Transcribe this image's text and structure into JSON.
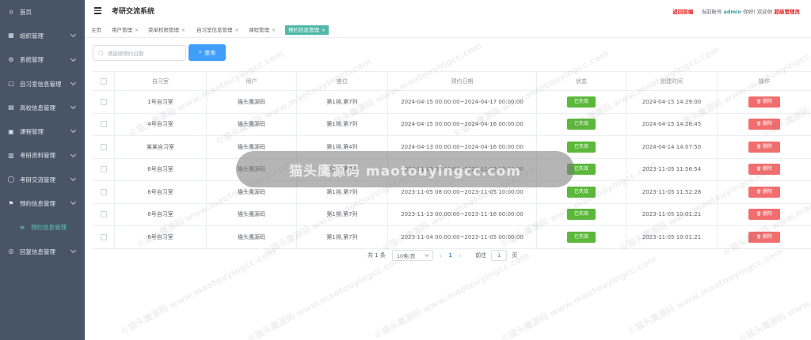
{
  "sidebar": {
    "items": [
      {
        "label": "首页",
        "icon": "home-icon",
        "glyph": "⌂"
      },
      {
        "label": "组织管理",
        "icon": "grid-icon",
        "glyph": "▦"
      },
      {
        "label": "系统管理",
        "icon": "gear-icon",
        "glyph": "⚙"
      },
      {
        "label": "自习室信息管理",
        "icon": "book-icon",
        "glyph": "▢"
      },
      {
        "label": "高校信息管理",
        "icon": "building-icon",
        "glyph": "▤"
      },
      {
        "label": "课程管理",
        "icon": "image-icon",
        "glyph": "▣"
      },
      {
        "label": "考研资料管理",
        "icon": "document-icon",
        "glyph": "▥"
      },
      {
        "label": "考研交流管理",
        "icon": "chat-icon",
        "glyph": "◯"
      },
      {
        "label": "预约信息管理",
        "icon": "flag-icon",
        "glyph": "⚑"
      },
      {
        "label": "预约信息管理",
        "icon": "list-icon",
        "glyph": "≡"
      },
      {
        "label": "回复信息管理",
        "icon": "reply-icon",
        "glyph": "◎"
      }
    ]
  },
  "header": {
    "title": "考研交流系统",
    "back_label": "返回前端",
    "account_prefix": "当前账号",
    "username": "admin",
    "greeting": "你好! 欢迎你",
    "role": "超级管理员"
  },
  "tags": [
    {
      "label": "主页",
      "closable": false,
      "active": false
    },
    {
      "label": "用户管理",
      "closable": true,
      "active": false
    },
    {
      "label": "菜单权限管理",
      "closable": true,
      "active": false
    },
    {
      "label": "自习室信息管理",
      "closable": true,
      "active": false
    },
    {
      "label": "课程管理",
      "closable": true,
      "active": false
    },
    {
      "label": "预约信息管理",
      "closable": true,
      "active": true
    }
  ],
  "search": {
    "placeholder": "请选择预约日期",
    "button_label": "查询"
  },
  "table": {
    "headers": [
      "自习室",
      "用户",
      "座位",
      "预约日期",
      "状态",
      "创建时间",
      "操作"
    ],
    "rows": [
      {
        "room": "1号自习室",
        "user": "猫头鹰源码",
        "seat": "第1排,第7列",
        "date": "2024-04-15 00:00:00~2024-04-17 00:00:00",
        "status": "已失效",
        "created": "2024-04-15 14:29:00",
        "action": "删除"
      },
      {
        "room": "4号自习室",
        "user": "猫头鹰源码",
        "seat": "第1排,第7列",
        "date": "2024-04-15 00:00:00~2024-04-16 00:00:00",
        "status": "已失效",
        "created": "2024-04-15 14:28:45",
        "action": "删除"
      },
      {
        "room": "某某自习室",
        "user": "猫头鹰源码",
        "seat": "第1排,第4列",
        "date": "2024-04-13 00:00:00~2024-04-16 00:00:00",
        "status": "已失效",
        "created": "2024-04-14 14:07:50",
        "action": "删除"
      },
      {
        "room": "6号自习室",
        "user": "猫头鹰源码",
        "seat": "第1排,第8列",
        "date": "2023-11-05 00:00:00~2023-11-06 00:00:00",
        "status": "已失效",
        "created": "2023-11-05 11:56:54",
        "action": "删除"
      },
      {
        "room": "6号自习室",
        "user": "猫头鹰源码",
        "seat": "第1排,第7列",
        "date": "2023-11-05 08:00:00~2023-11-05 10:00:00",
        "status": "已失效",
        "created": "2023-11-05 11:52:28",
        "action": "删除"
      },
      {
        "room": "6号自习室",
        "user": "猫头鹰源码",
        "seat": "第1排,第7列",
        "date": "2023-11-13 00:00:00~2023-11-16 00:00:00",
        "status": "已失效",
        "created": "2023-11-05 10:01:21",
        "action": "删除"
      },
      {
        "room": "6号自习室",
        "user": "猫头鹰源码",
        "seat": "第1排,第7列",
        "date": "2023-11-04 00:00:00~2023-11-05 00:00:00",
        "status": "已失效",
        "created": "2023-11-05 10:01:21",
        "action": "删除"
      }
    ]
  },
  "pagination": {
    "total_label": "共 1 条",
    "page_size": "10条/页",
    "current_page": "1",
    "goto_label": "前往",
    "goto_value": "1",
    "page_suffix": "页"
  },
  "watermark": {
    "banner": "猫头鹰源码 maotouyingcc.com",
    "tile": "©猫头鹰源码 www.maotouyingcc.com"
  },
  "colors": {
    "sidebar_bg": "#485568",
    "accent": "#50b9a8",
    "primary": "#3f9efa",
    "success": "#5bb83a",
    "danger": "#f26d6d",
    "alert_text": "#e02020"
  }
}
